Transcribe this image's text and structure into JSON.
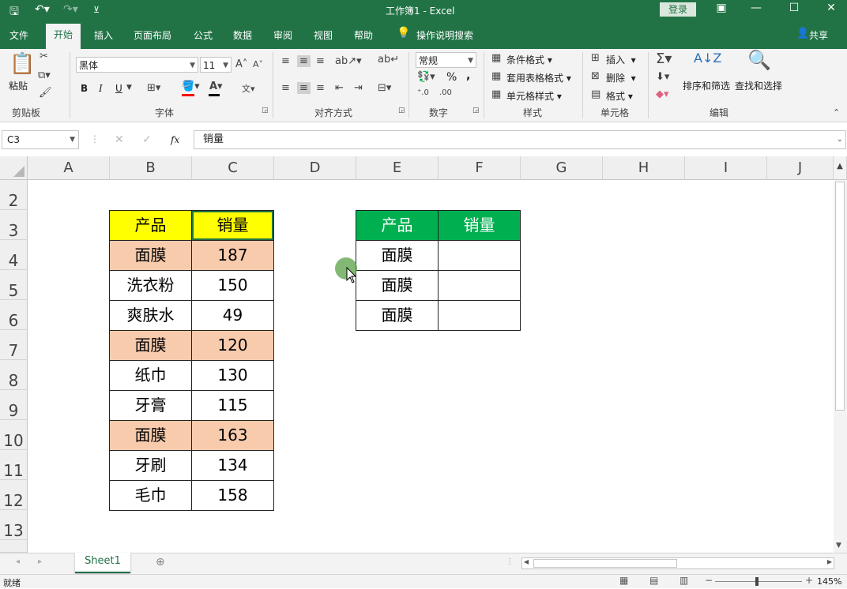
{
  "title": {
    "doc": "工作簿1",
    "sep": "-",
    "app": "Excel",
    "login": "登录"
  },
  "tabs": [
    "文件",
    "开始",
    "插入",
    "页面布局",
    "公式",
    "数据",
    "审阅",
    "视图",
    "帮助"
  ],
  "tell_me": "操作说明搜索",
  "share": "共享",
  "ribbon": {
    "clipboard": {
      "paste": "粘贴",
      "label": "剪贴板"
    },
    "font": {
      "name": "黑体",
      "size": "11",
      "bold": "B",
      "italic": "I",
      "underline": "U",
      "label": "字体"
    },
    "alignment": {
      "label": "对齐方式"
    },
    "number": {
      "format": "常规",
      "percent": "%",
      "comma": ",",
      "label": "数字"
    },
    "styles": {
      "conditional": "条件格式",
      "table": "套用表格格式",
      "cell": "单元格样式",
      "label": "样式"
    },
    "cells": {
      "insert": "插入",
      "delete": "删除",
      "format": "格式",
      "label": "单元格"
    },
    "editing": {
      "sort": "排序和筛选",
      "find": "查找和选择",
      "label": "编辑"
    }
  },
  "formula_bar": {
    "name_box": "C3",
    "fx": "fx",
    "value": "销量"
  },
  "columns": [
    "A",
    "B",
    "C",
    "D",
    "E",
    "F",
    "G",
    "H",
    "I",
    "J"
  ],
  "rows": [
    "2",
    "3",
    "4",
    "5",
    "6",
    "7",
    "8",
    "9",
    "10",
    "11",
    "12",
    "13"
  ],
  "table1": {
    "header": [
      "产品",
      "销量"
    ],
    "rows": [
      [
        "面膜",
        "187"
      ],
      [
        "洗衣粉",
        "150"
      ],
      [
        "爽肤水",
        "49"
      ],
      [
        "面膜",
        "120"
      ],
      [
        "纸巾",
        "130"
      ],
      [
        "牙膏",
        "115"
      ],
      [
        "面膜",
        "163"
      ],
      [
        "牙刷",
        "134"
      ],
      [
        "毛巾",
        "158"
      ]
    ]
  },
  "table2": {
    "header": [
      "产品",
      "销量"
    ],
    "rows": [
      [
        "面膜",
        ""
      ],
      [
        "面膜",
        ""
      ],
      [
        "面膜",
        ""
      ]
    ]
  },
  "colors": {
    "excel_green": "#217346",
    "header_yellow": "#ffff00",
    "header_green": "#00b050",
    "highlight": "#f8cbad"
  },
  "sheet_tab": "Sheet1",
  "status": {
    "ready": "就绪",
    "zoom": "145%"
  }
}
